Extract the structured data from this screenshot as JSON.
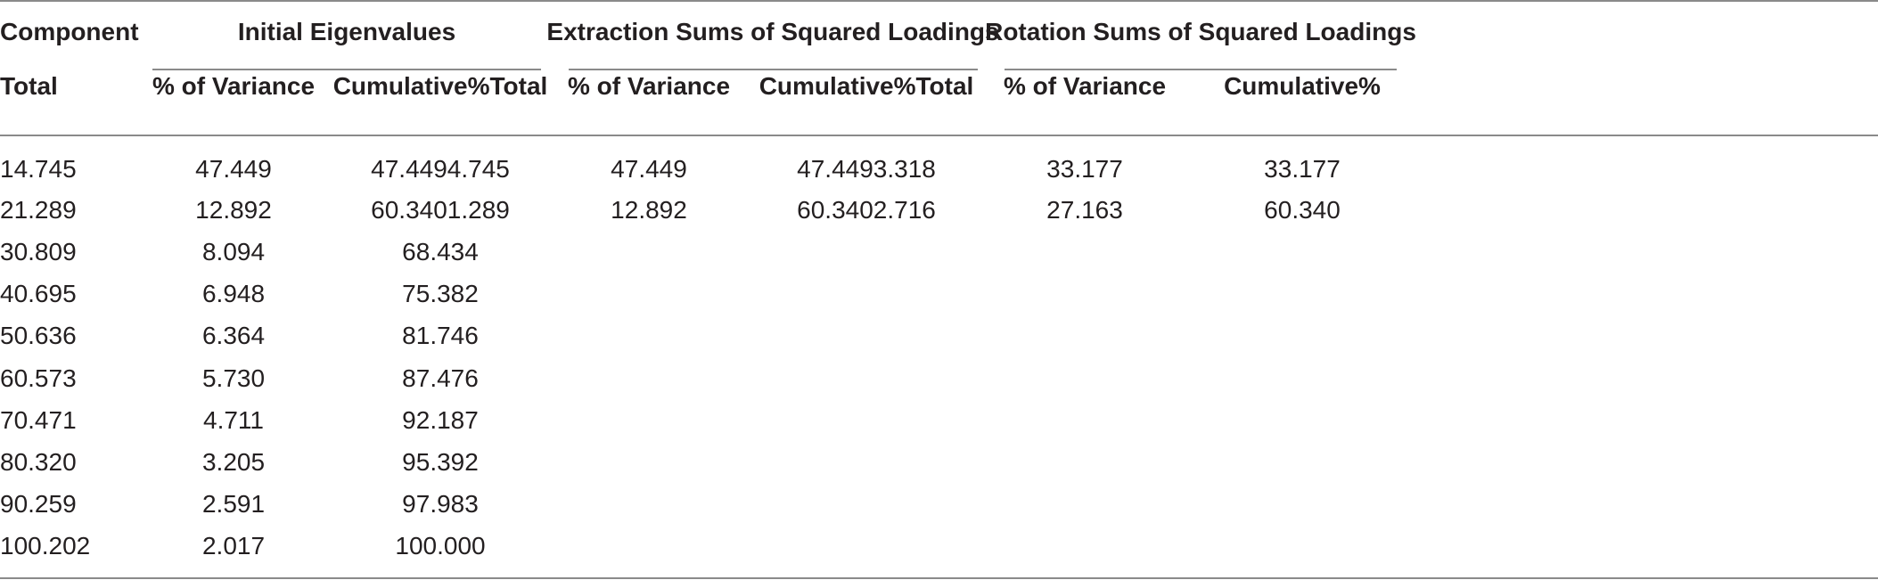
{
  "table": {
    "header": {
      "component": "Component",
      "group_initial": "Initial Eigenvalues",
      "group_extraction": "Extraction Sums of Squared Loadings",
      "group_rotation": "Rotation Sums of Squared Loadings",
      "sub": [
        "Total",
        "% of Variance",
        "Cumulative%Total",
        "% of Variance",
        "Cumulative%Total",
        "% of Variance",
        "Cumulative%"
      ]
    },
    "rows": [
      [
        "14.745",
        "47.449",
        "47.4494.745",
        "47.449",
        "47.4493.318",
        "33.177",
        "33.177"
      ],
      [
        "21.289",
        "12.892",
        "60.3401.289",
        "12.892",
        "60.3402.716",
        "27.163",
        "60.340"
      ],
      [
        "30.809",
        "8.094",
        "68.434",
        "",
        "",
        "",
        ""
      ],
      [
        "40.695",
        "6.948",
        "75.382",
        "",
        "",
        "",
        ""
      ],
      [
        "50.636",
        "6.364",
        "81.746",
        "",
        "",
        "",
        ""
      ],
      [
        "60.573",
        "5.730",
        "87.476",
        "",
        "",
        "",
        ""
      ],
      [
        "70.471",
        "4.711",
        "92.187",
        "",
        "",
        "",
        ""
      ],
      [
        "80.320",
        "3.205",
        "95.392",
        "",
        "",
        "",
        ""
      ],
      [
        "90.259",
        "2.591",
        "97.983",
        "",
        "",
        "",
        ""
      ],
      [
        "100.202",
        "2.017",
        "100.000",
        "",
        "",
        "",
        ""
      ]
    ]
  }
}
